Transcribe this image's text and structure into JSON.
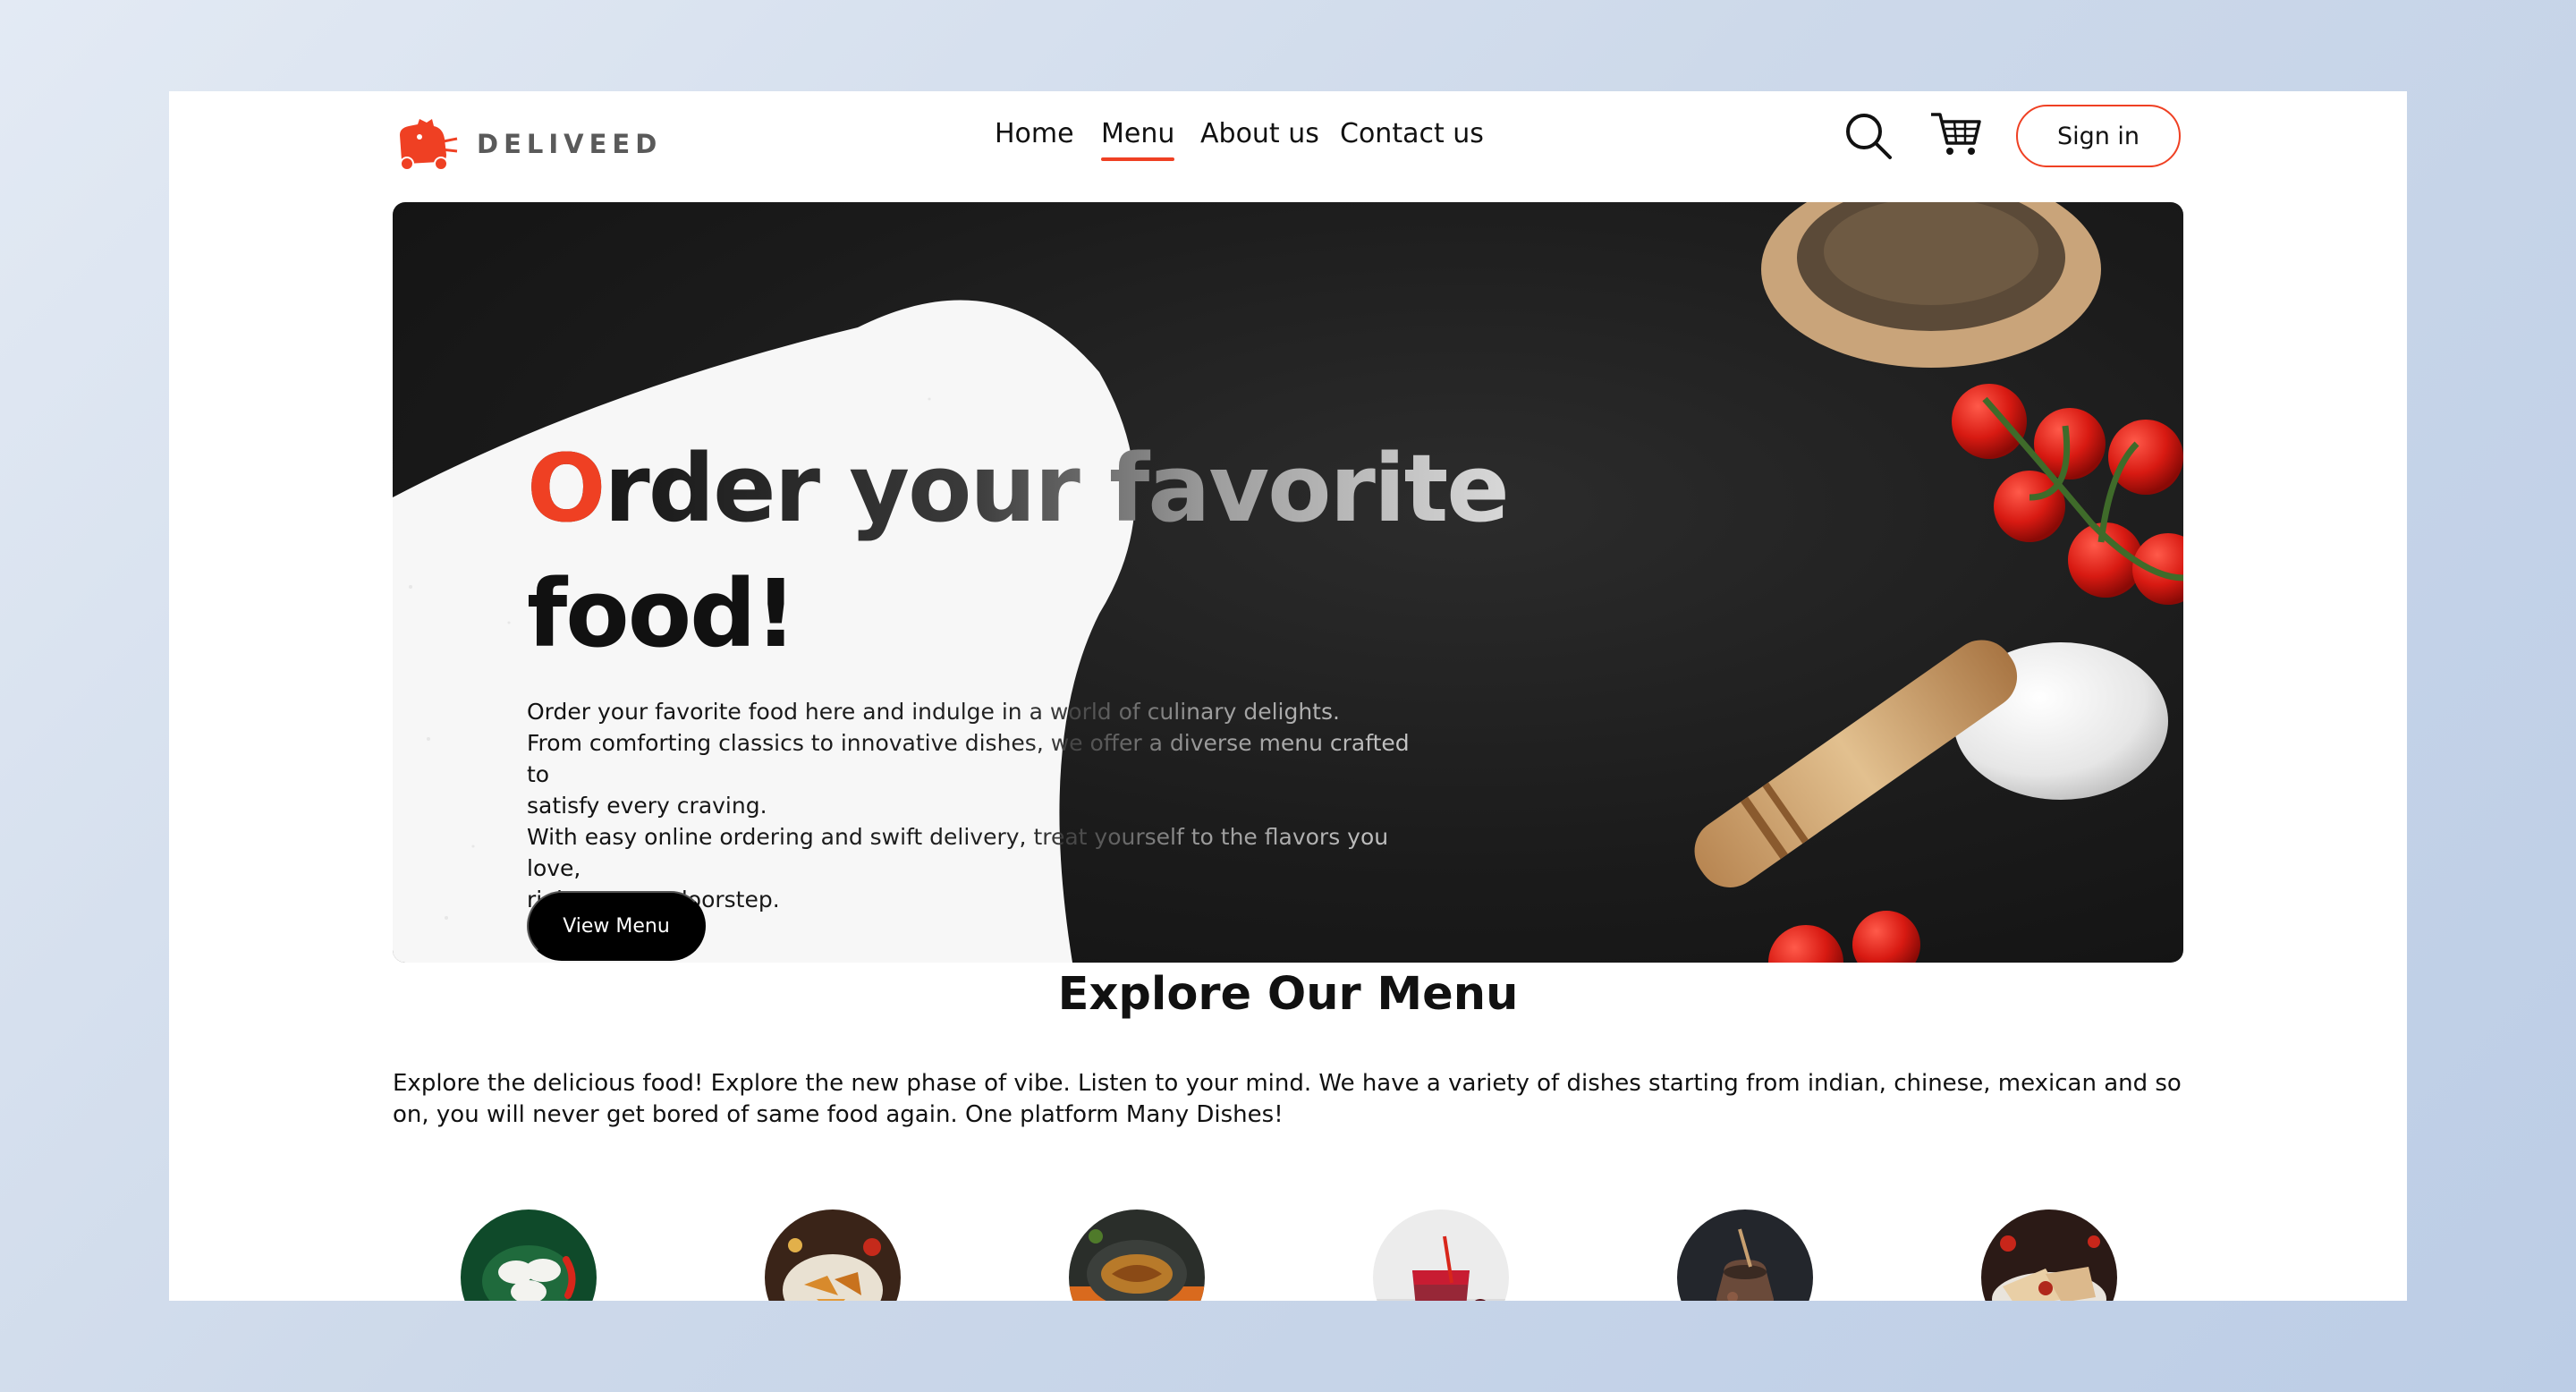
{
  "app": {
    "brand": "DELIVEED",
    "accent_color": "#ef4023"
  },
  "nav": {
    "items": [
      {
        "label": "Home",
        "active": false
      },
      {
        "label": "Menu",
        "active": true
      },
      {
        "label": "About us",
        "active": false
      },
      {
        "label": "Contact us",
        "active": false
      }
    ],
    "icons": [
      "search-icon",
      "cart-icon"
    ],
    "signin_label": "Sign in"
  },
  "hero": {
    "title_first_letter": "O",
    "title_line1_rest": "rder your favorite",
    "title_line2": "food!",
    "description_lines": [
      "Order your favorite food here and indulge in a world of culinary delights.",
      "From comforting classics to innovative dishes, we offer a diverse menu crafted to",
      "satisfy every craving.",
      "With easy online ordering and swift delivery, treat yourself to the flavors you love,",
      "right at your doorstep."
    ],
    "cta_label": "View Menu"
  },
  "explore": {
    "title": "Explore Our Menu",
    "description": "Explore the delicious food! Explore the new phase of vibe. Listen to your mind. We have a variety of dishes starting from indian, chinese, mexican and so on, you will never get bored of same food again. One platform Many Dishes!",
    "dish_thumbnails": [
      "idli-dish",
      "fried-snacks-dish",
      "fish-curry-dish",
      "red-drink-dish",
      "clay-pot-dish",
      "wrap-dish"
    ]
  }
}
